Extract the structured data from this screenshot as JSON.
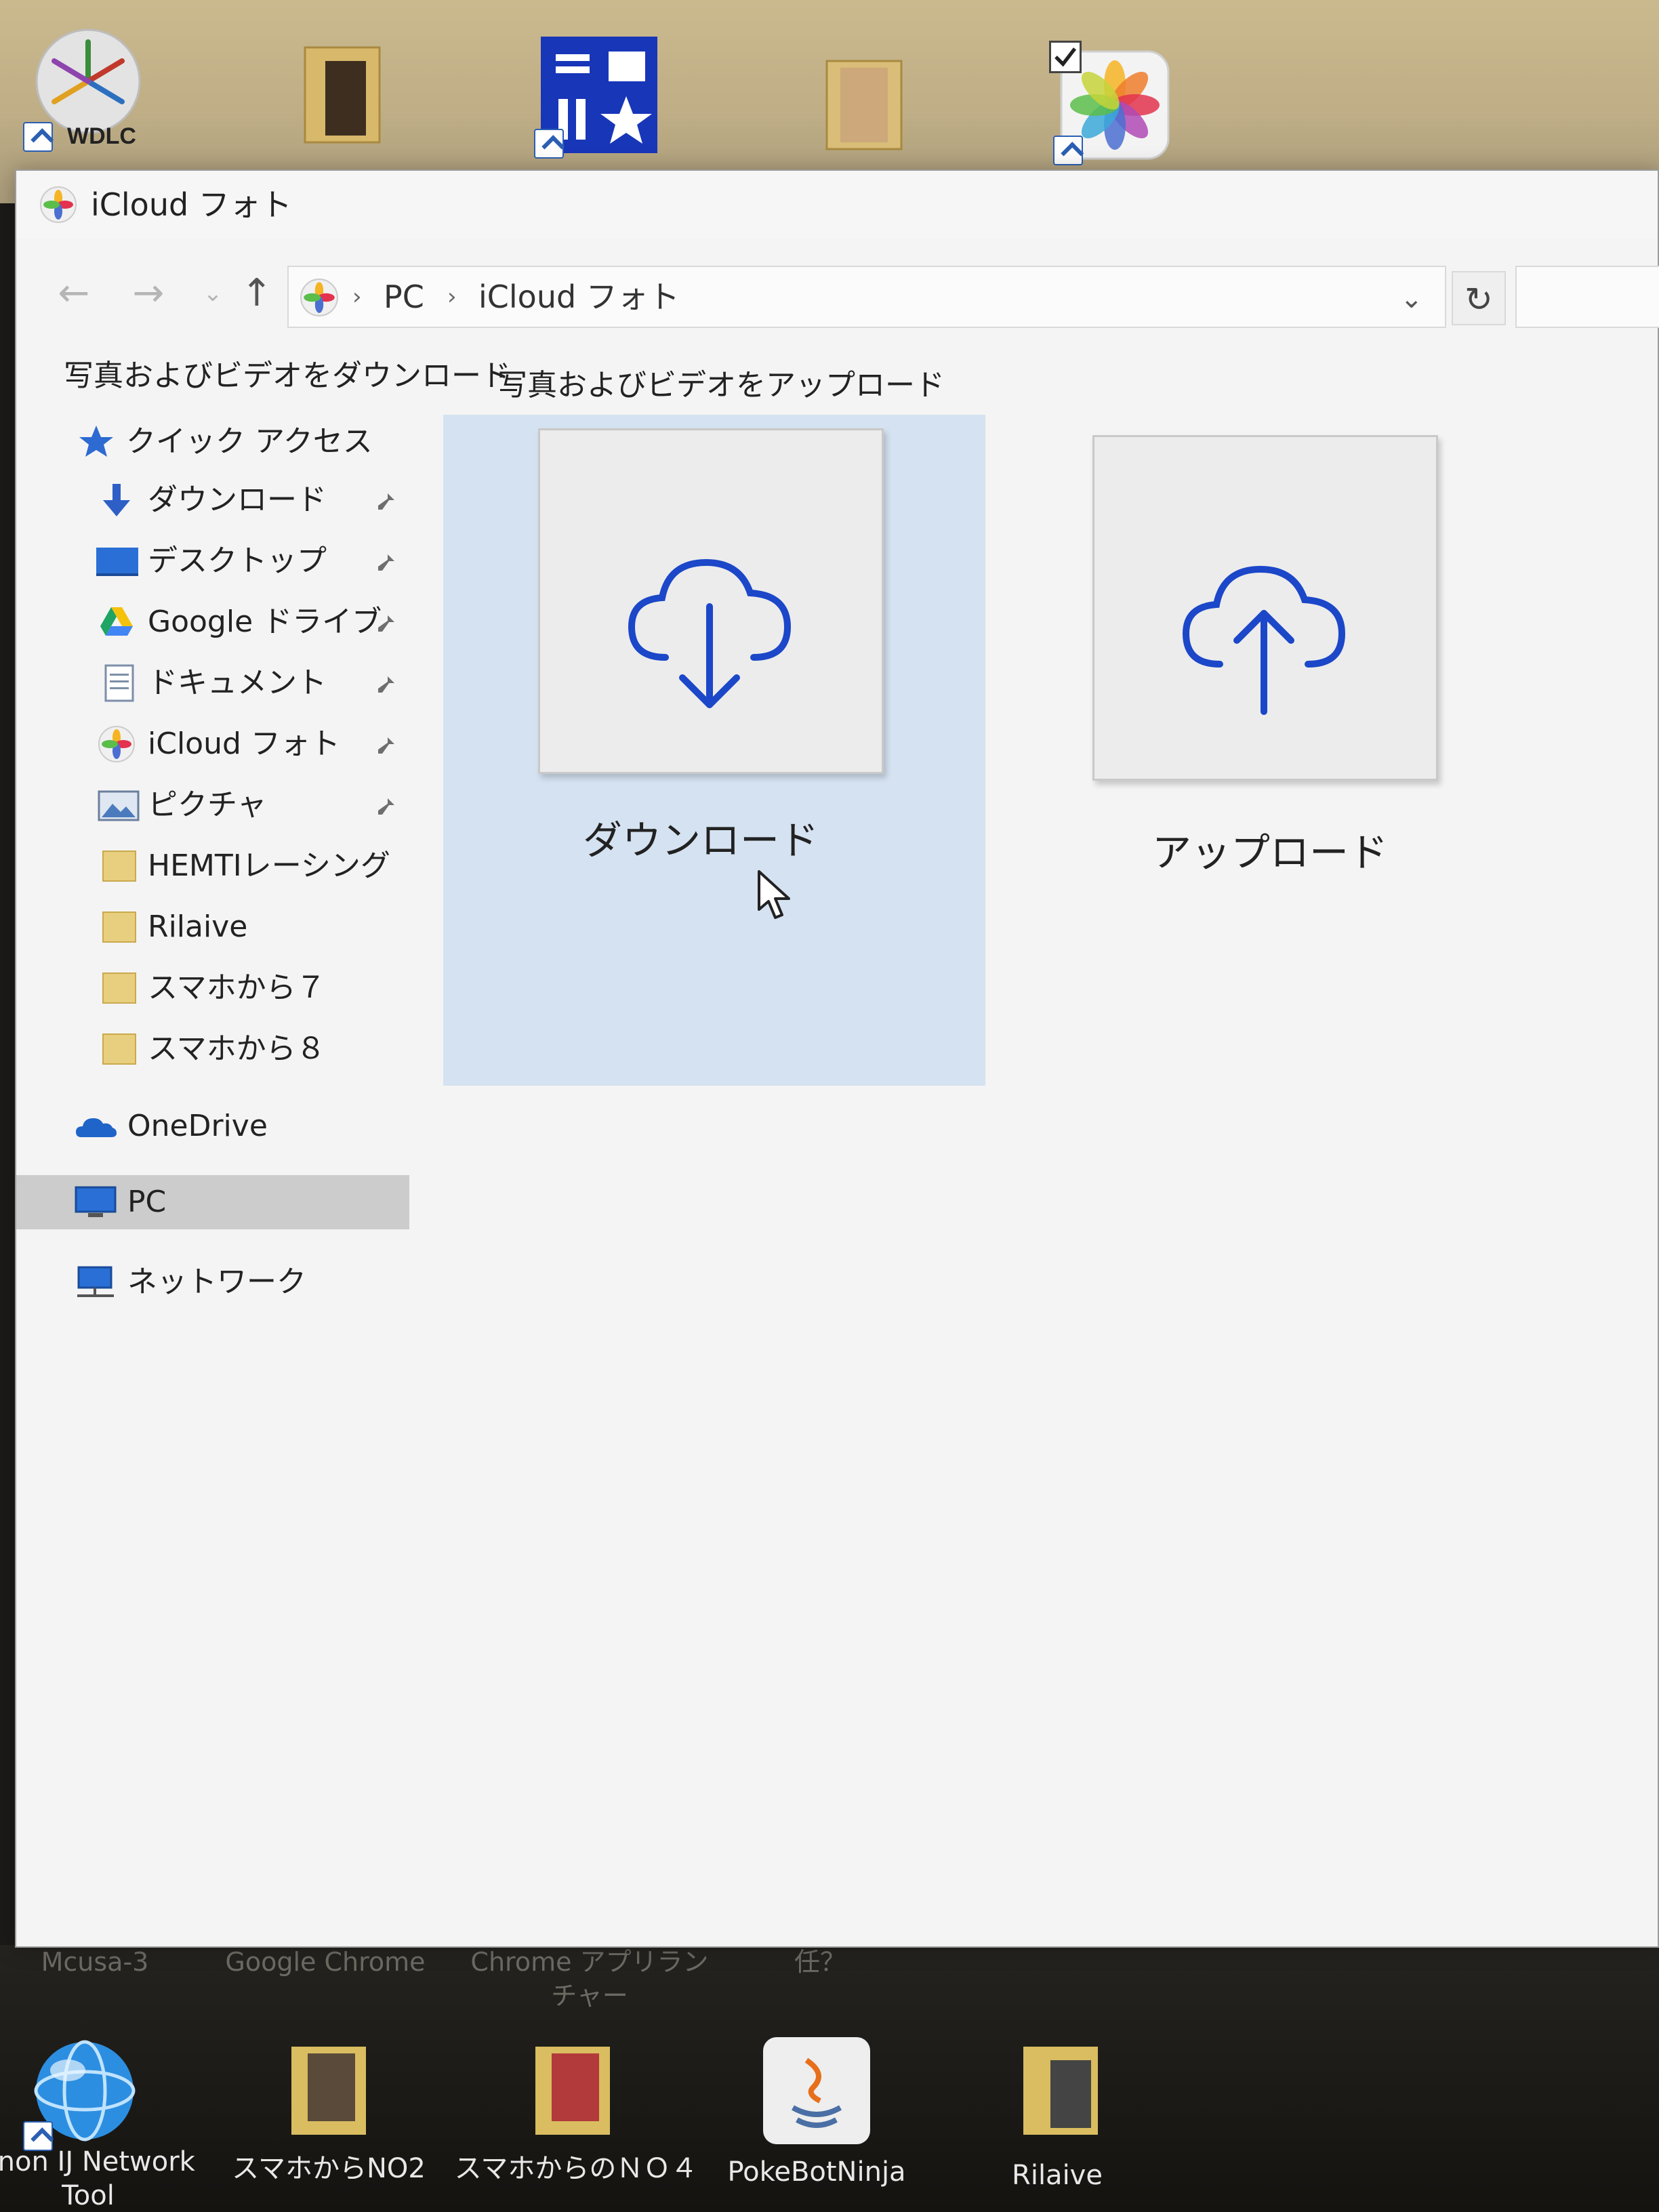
{
  "desktop": {
    "top_icons": [
      {
        "name": "wdlc",
        "label": "WDLC"
      },
      {
        "name": "folder-1",
        "label": ""
      },
      {
        "name": "tools",
        "label": ""
      },
      {
        "name": "folder-2",
        "label": ""
      },
      {
        "name": "photos",
        "label": ""
      }
    ],
    "partial_labels": {
      "label_a": "Mcusa-3",
      "label_b": "Google Chrome",
      "label_c": "Chrome アプリランチャー",
      "label_d": "任？"
    },
    "bottom_icons": [
      {
        "name": "canon-ij-network-tool",
        "label": "anon IJ Network Tool"
      },
      {
        "name": "sumaho-kara-no2",
        "label": "スマホからNO2"
      },
      {
        "name": "sumaho-kara-no4",
        "label": "スマホからのＮＯ４"
      },
      {
        "name": "pokebotninja",
        "label": "PokeBotNinja"
      },
      {
        "name": "rilaive-desktop",
        "label": "Rilaive"
      }
    ]
  },
  "window": {
    "title": "iCloud フォト",
    "address": {
      "crumbs": [
        "PC",
        "iCloud フォト"
      ],
      "separator": "›"
    },
    "nav_glyphs": {
      "back": "←",
      "forward": "→",
      "up": "↑",
      "dropdown": "⌄",
      "refresh": "↻"
    },
    "toolbar": {
      "download_label": "写真およびビデオをダウンロード",
      "upload_label": "写真およびビデオをアップロード"
    },
    "nav_pane": {
      "quick_access": "クイック アクセス",
      "items": [
        {
          "label": "ダウンロード",
          "icon": "download-arrow-icon",
          "pinned": true
        },
        {
          "label": "デスクトップ",
          "icon": "desktop-icon",
          "pinned": true
        },
        {
          "label": "Google ドライブ",
          "icon": "google-drive-icon",
          "pinned": true
        },
        {
          "label": "ドキュメント",
          "icon": "document-icon",
          "pinned": true
        },
        {
          "label": "iCloud フォト",
          "icon": "icloud-photos-icon",
          "pinned": true
        },
        {
          "label": "ピクチャ",
          "icon": "pictures-icon",
          "pinned": true
        },
        {
          "label": "HEMTIレーシング",
          "icon": "folder-icon",
          "pinned": false
        },
        {
          "label": "Rilaive",
          "icon": "folder-icon",
          "pinned": false
        },
        {
          "label": "スマホから７",
          "icon": "folder-icon",
          "pinned": false
        },
        {
          "label": "スマホから８",
          "icon": "folder-icon",
          "pinned": false
        }
      ],
      "onedrive": "OneDrive",
      "pc": "PC",
      "network": "ネットワーク"
    },
    "tiles": {
      "download": "ダウンロード",
      "upload": "アップロード"
    }
  },
  "colors": {
    "accent_blue": "#1b47c8",
    "selection_gray": "#cccccc",
    "hover_blue": "#c8daf0"
  }
}
